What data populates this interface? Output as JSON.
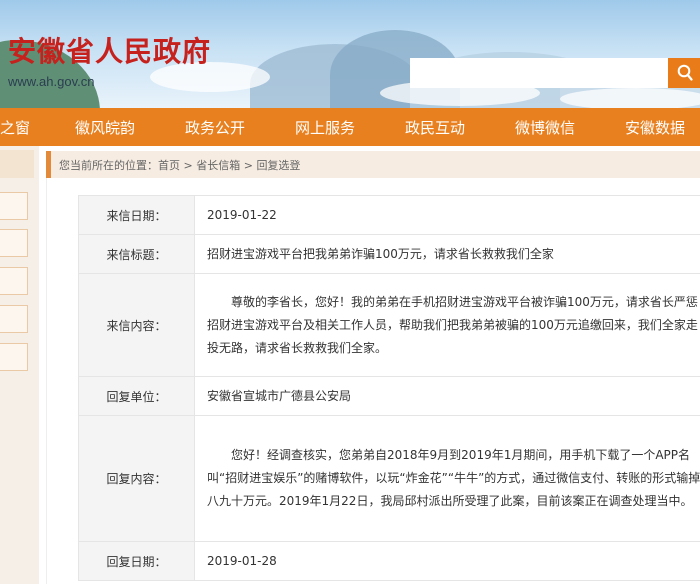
{
  "header": {
    "title": "安徽省人民政府",
    "url": "www.ah.gov.cn",
    "search_placeholder": ""
  },
  "nav": {
    "items": [
      "之窗",
      "徽风皖韵",
      "政务公开",
      "网上服务",
      "政民互动",
      "微博微信",
      "安徽数据"
    ]
  },
  "breadcrumb": {
    "prefix": "您当前所在的位置：",
    "home": "首页",
    "sep1": " > ",
    "section": "省长信箱",
    "sep2": " > ",
    "current": "回复选登"
  },
  "letter": {
    "date_label": "来信日期：",
    "date": "2019-01-22",
    "subject_label": "来信标题：",
    "subject": "招财进宝游戏平台把我弟弟诈骗100万元，请求省长救救我们全家",
    "content_label": "来信内容：",
    "content": "尊敬的李省长，您好！我的弟弟在手机招财进宝游戏平台被诈骗100万元，请求省长严惩招财进宝游戏平台及相关工作人员，帮助我们把我弟弟被骗的100万元追缴回来，我们全家走投无路，请求省长救救我们全家。",
    "reply_unit_label": "回复单位：",
    "reply_unit": "安徽省宣城市广德县公安局",
    "reply_content_label": "回复内容：",
    "reply_content": "您好！经调查核实，您弟弟自2018年9月到2019年1月期间，用手机下载了一个APP名叫“招财进宝娱乐”的赌博软件，以玩“炸金花”“牛牛”的方式，通过微信支付、转账的形式输掉八九十万元。2019年1月22日，我局邱村派出所受理了此案，目前该案正在调查处理当中。",
    "reply_date_label": "回复日期：",
    "reply_date": "2019-01-28"
  },
  "colors": {
    "nav_bg": "#e8801f",
    "title_red": "#c6211d",
    "search_orange": "#e97b18"
  },
  "icons": {
    "search": "search-icon"
  }
}
